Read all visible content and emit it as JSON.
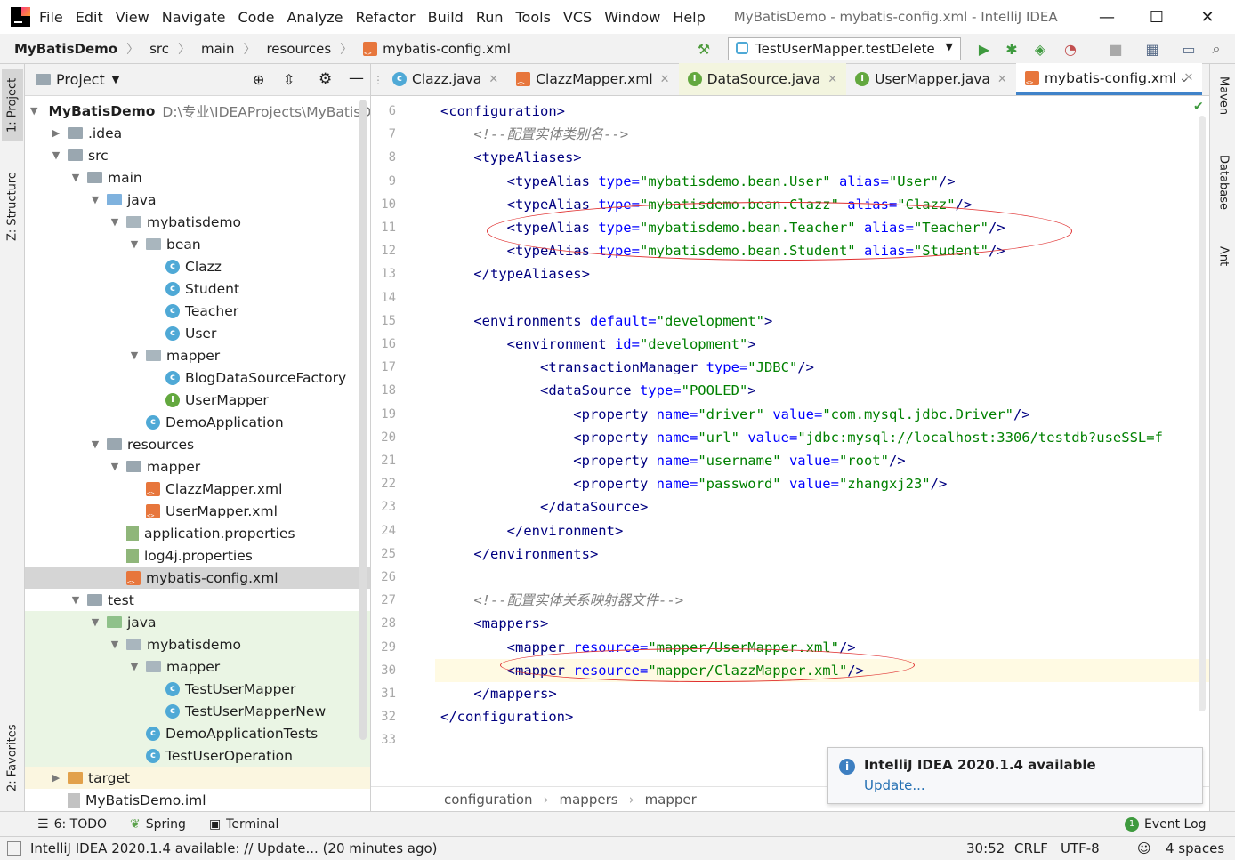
{
  "window": {
    "menu": [
      "File",
      "Edit",
      "View",
      "Navigate",
      "Code",
      "Analyze",
      "Refactor",
      "Build",
      "Run",
      "Tools",
      "VCS",
      "Window",
      "Help"
    ],
    "title": "MyBatisDemo - mybatis-config.xml - IntelliJ IDEA"
  },
  "breadcrumb": [
    "MyBatisDemo",
    "src",
    "main",
    "resources",
    "mybatis-config.xml"
  ],
  "run_config": "TestUserMapper.testDelete",
  "left_tabs": {
    "project": "1: Project",
    "structure": "Z: Structure",
    "favorites": "2: Favorites"
  },
  "right_tabs": {
    "maven": "Maven",
    "database": "Database",
    "ant": "Ant"
  },
  "project_panel": {
    "title": "Project",
    "root_path": "D:\\专业\\IDEAProjects\\MyBatisDe",
    "tree": [
      {
        "label": "MyBatisDemo",
        "depth": 0,
        "kind": "module",
        "arrow": "down",
        "bold": true
      },
      {
        "label": ".idea",
        "depth": 1,
        "kind": "folder",
        "arrow": "right"
      },
      {
        "label": "src",
        "depth": 1,
        "kind": "folder",
        "arrow": "down"
      },
      {
        "label": "main",
        "depth": 2,
        "kind": "folder",
        "arrow": "down"
      },
      {
        "label": "java",
        "depth": 3,
        "kind": "folder-blue",
        "arrow": "down"
      },
      {
        "label": "mybatisdemo",
        "depth": 4,
        "kind": "package",
        "arrow": "down"
      },
      {
        "label": "bean",
        "depth": 5,
        "kind": "package",
        "arrow": "down"
      },
      {
        "label": "Clazz",
        "depth": 6,
        "kind": "class"
      },
      {
        "label": "Student",
        "depth": 6,
        "kind": "class"
      },
      {
        "label": "Teacher",
        "depth": 6,
        "kind": "class"
      },
      {
        "label": "User",
        "depth": 6,
        "kind": "class"
      },
      {
        "label": "mapper",
        "depth": 5,
        "kind": "package",
        "arrow": "down"
      },
      {
        "label": "BlogDataSourceFactory",
        "depth": 6,
        "kind": "class"
      },
      {
        "label": "UserMapper",
        "depth": 6,
        "kind": "interface"
      },
      {
        "label": "DemoApplication",
        "depth": 5,
        "kind": "class"
      },
      {
        "label": "resources",
        "depth": 3,
        "kind": "folder-res",
        "arrow": "down"
      },
      {
        "label": "mapper",
        "depth": 4,
        "kind": "folder",
        "arrow": "down"
      },
      {
        "label": "ClazzMapper.xml",
        "depth": 5,
        "kind": "xml"
      },
      {
        "label": "UserMapper.xml",
        "depth": 5,
        "kind": "xml"
      },
      {
        "label": "application.properties",
        "depth": 4,
        "kind": "props"
      },
      {
        "label": "log4j.properties",
        "depth": 4,
        "kind": "props"
      },
      {
        "label": "mybatis-config.xml",
        "depth": 4,
        "kind": "xml",
        "selected": true
      },
      {
        "label": "test",
        "depth": 2,
        "kind": "folder",
        "arrow": "down"
      },
      {
        "label": "java",
        "depth": 3,
        "kind": "folder-green",
        "arrow": "down",
        "test": true
      },
      {
        "label": "mybatisdemo",
        "depth": 4,
        "kind": "package",
        "arrow": "down",
        "test": true
      },
      {
        "label": "mapper",
        "depth": 5,
        "kind": "package",
        "arrow": "down",
        "test": true
      },
      {
        "label": "TestUserMapper",
        "depth": 6,
        "kind": "class",
        "test": true
      },
      {
        "label": "TestUserMapperNew",
        "depth": 6,
        "kind": "class",
        "test": true
      },
      {
        "label": "DemoApplicationTests",
        "depth": 5,
        "kind": "class",
        "test": true
      },
      {
        "label": "TestUserOperation",
        "depth": 5,
        "kind": "class",
        "test": true
      },
      {
        "label": "target",
        "depth": 1,
        "kind": "folder-orange",
        "arrow": "right",
        "excluded": true
      },
      {
        "label": "MyBatisDemo.iml",
        "depth": 1,
        "kind": "file"
      }
    ]
  },
  "tabs": [
    {
      "label": "Clazz.java",
      "icon": "class"
    },
    {
      "label": "ClazzMapper.xml",
      "icon": "xml"
    },
    {
      "label": "DataSource.java",
      "icon": "interface",
      "highlight": true
    },
    {
      "label": "UserMapper.java",
      "icon": "interface"
    },
    {
      "label": "mybatis-config.xml",
      "icon": "xml",
      "active": true
    }
  ],
  "code": {
    "first_line": 6,
    "lines": [
      [
        [
          "tg",
          "<configuration>"
        ]
      ],
      [
        [
          "cm",
          "    <!--配置实体类别名-->"
        ]
      ],
      [
        [
          "tg",
          "    <typeAliases>"
        ]
      ],
      [
        [
          "tg",
          "        <typeAlias "
        ],
        [
          "an",
          "type="
        ],
        [
          "av",
          "\"mybatisdemo.bean.User\" "
        ],
        [
          "an",
          "alias="
        ],
        [
          "av",
          "\"User\""
        ],
        [
          "tg",
          "/>"
        ]
      ],
      [
        [
          "tg",
          "        <typeAlias "
        ],
        [
          "an",
          "type="
        ],
        [
          "av",
          "\"mybatisdemo.bean.Clazz\" "
        ],
        [
          "an",
          "alias="
        ],
        [
          "av",
          "\"Clazz\""
        ],
        [
          "tg",
          "/>"
        ]
      ],
      [
        [
          "tg",
          "        <typeAlias "
        ],
        [
          "an",
          "type="
        ],
        [
          "av",
          "\"mybatisdemo.bean.Teacher\" "
        ],
        [
          "an",
          "alias="
        ],
        [
          "av",
          "\"Teacher\""
        ],
        [
          "tg",
          "/>"
        ]
      ],
      [
        [
          "tg",
          "        <typeAlias "
        ],
        [
          "an",
          "type="
        ],
        [
          "av",
          "\"mybatisdemo.bean.Student\" "
        ],
        [
          "an",
          "alias="
        ],
        [
          "av",
          "\"Student\""
        ],
        [
          "tg",
          "/>"
        ]
      ],
      [
        [
          "tg",
          "    </typeAliases>"
        ]
      ],
      [],
      [
        [
          "tg",
          "    <environments "
        ],
        [
          "an",
          "default="
        ],
        [
          "av",
          "\"development\""
        ],
        [
          "tg",
          ">"
        ]
      ],
      [
        [
          "tg",
          "        <environment "
        ],
        [
          "an",
          "id="
        ],
        [
          "av",
          "\"development\""
        ],
        [
          "tg",
          ">"
        ]
      ],
      [
        [
          "tg",
          "            <transactionManager "
        ],
        [
          "an",
          "type="
        ],
        [
          "av",
          "\"JDBC\""
        ],
        [
          "tg",
          "/>"
        ]
      ],
      [
        [
          "tg",
          "            <dataSource "
        ],
        [
          "an",
          "type="
        ],
        [
          "av",
          "\"POOLED\""
        ],
        [
          "tg",
          ">"
        ]
      ],
      [
        [
          "tg",
          "                <property "
        ],
        [
          "an",
          "name="
        ],
        [
          "av",
          "\"driver\" "
        ],
        [
          "an",
          "value="
        ],
        [
          "av",
          "\"com.mysql.jdbc.Driver\""
        ],
        [
          "tg",
          "/>"
        ]
      ],
      [
        [
          "tg",
          "                <property "
        ],
        [
          "an",
          "name="
        ],
        [
          "av",
          "\"url\" "
        ],
        [
          "an",
          "value="
        ],
        [
          "av",
          "\"jdbc:mysql://localhost:3306/testdb?useSSL=f"
        ]
      ],
      [
        [
          "tg",
          "                <property "
        ],
        [
          "an",
          "name="
        ],
        [
          "av",
          "\"username\" "
        ],
        [
          "an",
          "value="
        ],
        [
          "av",
          "\"root\""
        ],
        [
          "tg",
          "/>"
        ]
      ],
      [
        [
          "tg",
          "                <property "
        ],
        [
          "an",
          "name="
        ],
        [
          "av",
          "\"password\" "
        ],
        [
          "an",
          "value="
        ],
        [
          "av",
          "\"zhangxj23\""
        ],
        [
          "tg",
          "/>"
        ]
      ],
      [
        [
          "tg",
          "            </dataSource>"
        ]
      ],
      [
        [
          "tg",
          "        </environment>"
        ]
      ],
      [
        [
          "tg",
          "    </environments>"
        ]
      ],
      [],
      [
        [
          "cm",
          "    <!--配置实体关系映射器文件-->"
        ]
      ],
      [
        [
          "tg",
          "    <mappers>"
        ]
      ],
      [
        [
          "tg",
          "        <mapper "
        ],
        [
          "an",
          "resource="
        ],
        [
          "av",
          "\"mapper/UserMapper.xml\""
        ],
        [
          "tg",
          "/>"
        ]
      ],
      [
        [
          "tg",
          "        <mapper "
        ],
        [
          "an",
          "resource="
        ],
        [
          "av",
          "\"mapper/ClazzMapper.xml\""
        ],
        [
          "tg",
          "/>"
        ]
      ],
      [
        [
          "tg",
          "    </mappers>"
        ]
      ],
      [
        [
          "tg",
          "</configuration>"
        ]
      ],
      []
    ],
    "current_line": 30
  },
  "editor_breadcrumb": [
    "configuration",
    "mappers",
    "mapper"
  ],
  "notification": {
    "title": "IntelliJ IDEA 2020.1.4 available",
    "link": "Update..."
  },
  "tool_windows": [
    {
      "label": "6: TODO"
    },
    {
      "label": "Spring"
    },
    {
      "label": "Terminal"
    }
  ],
  "event_log": {
    "count": "1",
    "label": "Event Log"
  },
  "status": {
    "message": "IntelliJ IDEA 2020.1.4 available: // Update... (20 minutes ago)",
    "position": "30:52",
    "line_sep": "CRLF",
    "encoding": "UTF-8",
    "indent": "4 spaces"
  }
}
